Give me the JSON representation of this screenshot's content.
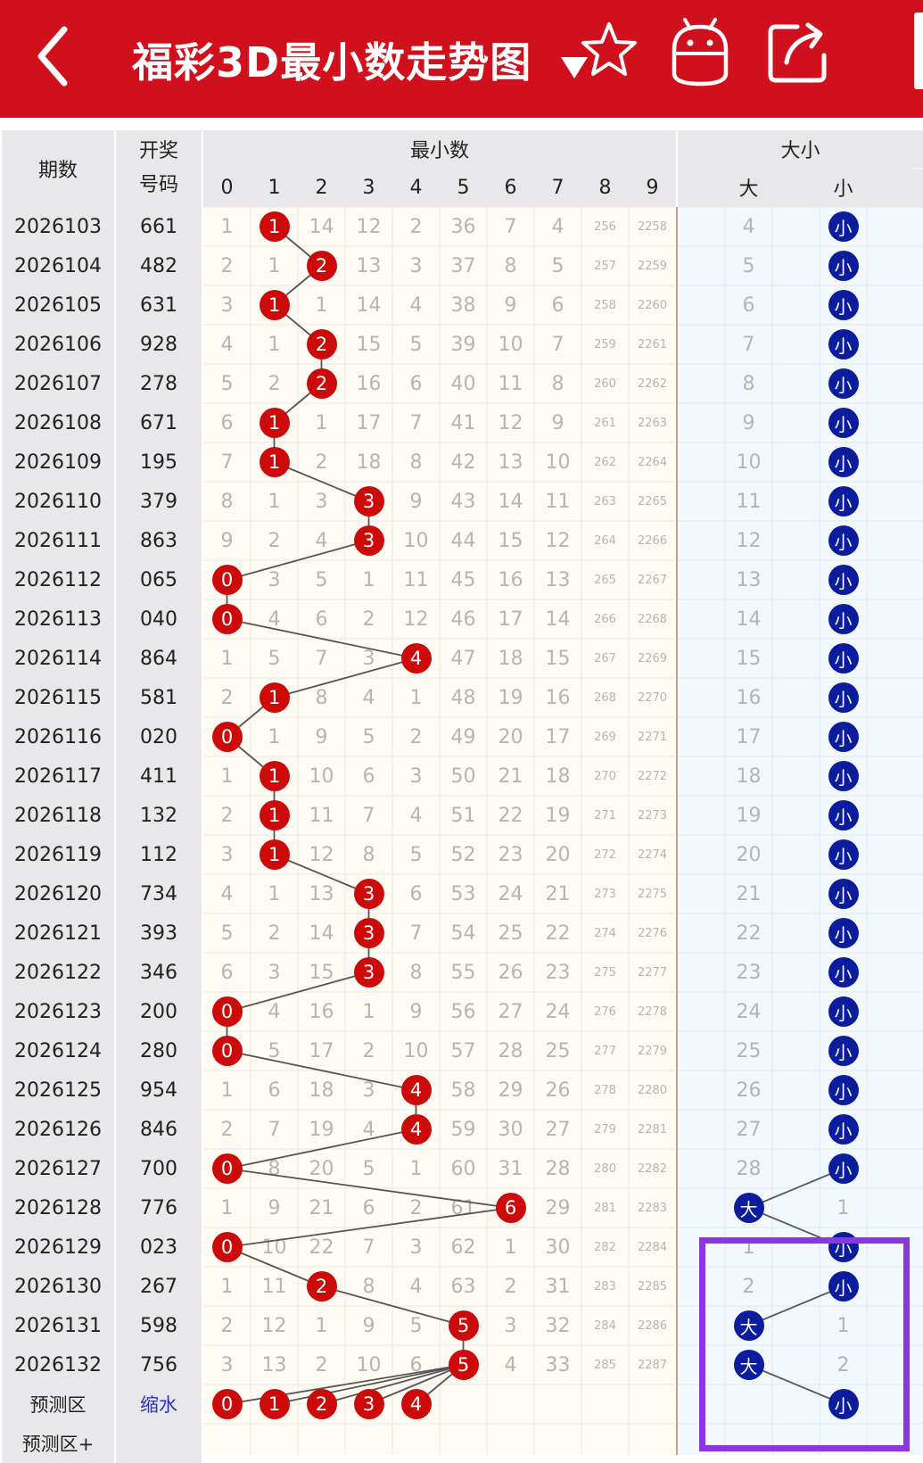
{
  "header": {
    "back_icon": "chevron-left-icon",
    "title": "福彩3D最小数走势图",
    "dropdown_icon": "triangle-down-icon",
    "favorite_icon": "star-icon",
    "robot_icon": "robot-icon",
    "share_icon": "share-icon"
  },
  "table": {
    "col_period": "期数",
    "col_number_line1": "开奖",
    "col_number_line2": "号码",
    "group_min": "最小数",
    "group_size": "大小",
    "digit_headers": [
      "0",
      "1",
      "2",
      "3",
      "4",
      "5",
      "6",
      "7",
      "8",
      "9"
    ],
    "size_headers": [
      "",
      "大",
      "",
      "小",
      ""
    ],
    "rows": [
      {
        "period": "2026103",
        "number": "661",
        "digits": [
          "1",
          "1",
          "14",
          "12",
          "2",
          "36",
          "7",
          "4",
          "256",
          "2258"
        ],
        "hit": 1,
        "size": "小",
        "size_cells": [
          "",
          "4",
          "",
          "小",
          ""
        ]
      },
      {
        "period": "2026104",
        "number": "482",
        "digits": [
          "2",
          "1",
          "2",
          "13",
          "3",
          "37",
          "8",
          "5",
          "257",
          "2259"
        ],
        "hit": 2,
        "size": "小",
        "size_cells": [
          "",
          "5",
          "",
          "小",
          ""
        ]
      },
      {
        "period": "2026105",
        "number": "631",
        "digits": [
          "3",
          "1",
          "1",
          "14",
          "4",
          "38",
          "9",
          "6",
          "258",
          "2260"
        ],
        "hit": 1,
        "size": "小",
        "size_cells": [
          "",
          "6",
          "",
          "小",
          ""
        ]
      },
      {
        "period": "2026106",
        "number": "928",
        "digits": [
          "4",
          "1",
          "2",
          "15",
          "5",
          "39",
          "10",
          "7",
          "259",
          "2261"
        ],
        "hit": 2,
        "size": "小",
        "size_cells": [
          "",
          "7",
          "",
          "小",
          ""
        ]
      },
      {
        "period": "2026107",
        "number": "278",
        "digits": [
          "5",
          "2",
          "2",
          "16",
          "6",
          "40",
          "11",
          "8",
          "260",
          "2262"
        ],
        "hit": 2,
        "size": "小",
        "size_cells": [
          "",
          "8",
          "",
          "小",
          ""
        ]
      },
      {
        "period": "2026108",
        "number": "671",
        "digits": [
          "6",
          "1",
          "1",
          "17",
          "7",
          "41",
          "12",
          "9",
          "261",
          "2263"
        ],
        "hit": 1,
        "size": "小",
        "size_cells": [
          "",
          "9",
          "",
          "小",
          ""
        ]
      },
      {
        "period": "2026109",
        "number": "195",
        "digits": [
          "7",
          "1",
          "2",
          "18",
          "8",
          "42",
          "13",
          "10",
          "262",
          "2264"
        ],
        "hit": 1,
        "size": "小",
        "size_cells": [
          "",
          "10",
          "",
          "小",
          ""
        ]
      },
      {
        "period": "2026110",
        "number": "379",
        "digits": [
          "8",
          "1",
          "3",
          "3",
          "9",
          "43",
          "14",
          "11",
          "263",
          "2265"
        ],
        "hit": 3,
        "size": "小",
        "size_cells": [
          "",
          "11",
          "",
          "小",
          ""
        ]
      },
      {
        "period": "2026111",
        "number": "863",
        "digits": [
          "9",
          "2",
          "4",
          "3",
          "10",
          "44",
          "15",
          "12",
          "264",
          "2266"
        ],
        "hit": 3,
        "size": "小",
        "size_cells": [
          "",
          "12",
          "",
          "小",
          ""
        ]
      },
      {
        "period": "2026112",
        "number": "065",
        "digits": [
          "0",
          "3",
          "5",
          "1",
          "11",
          "45",
          "16",
          "13",
          "265",
          "2267"
        ],
        "hit": 0,
        "size": "小",
        "size_cells": [
          "",
          "13",
          "",
          "小",
          ""
        ]
      },
      {
        "period": "2026113",
        "number": "040",
        "digits": [
          "0",
          "4",
          "6",
          "2",
          "12",
          "46",
          "17",
          "14",
          "266",
          "2268"
        ],
        "hit": 0,
        "size": "小",
        "size_cells": [
          "",
          "14",
          "",
          "小",
          ""
        ]
      },
      {
        "period": "2026114",
        "number": "864",
        "digits": [
          "1",
          "5",
          "7",
          "3",
          "4",
          "47",
          "18",
          "15",
          "267",
          "2269"
        ],
        "hit": 4,
        "size": "小",
        "size_cells": [
          "",
          "15",
          "",
          "小",
          ""
        ]
      },
      {
        "period": "2026115",
        "number": "581",
        "digits": [
          "2",
          "1",
          "8",
          "4",
          "1",
          "48",
          "19",
          "16",
          "268",
          "2270"
        ],
        "hit": 1,
        "size": "小",
        "size_cells": [
          "",
          "16",
          "",
          "小",
          ""
        ]
      },
      {
        "period": "2026116",
        "number": "020",
        "digits": [
          "0",
          "1",
          "9",
          "5",
          "2",
          "49",
          "20",
          "17",
          "269",
          "2271"
        ],
        "hit": 0,
        "size": "小",
        "size_cells": [
          "",
          "17",
          "",
          "小",
          ""
        ]
      },
      {
        "period": "2026117",
        "number": "411",
        "digits": [
          "1",
          "1",
          "10",
          "6",
          "3",
          "50",
          "21",
          "18",
          "270",
          "2272"
        ],
        "hit": 1,
        "size": "小",
        "size_cells": [
          "",
          "18",
          "",
          "小",
          ""
        ]
      },
      {
        "period": "2026118",
        "number": "132",
        "digits": [
          "2",
          "1",
          "11",
          "7",
          "4",
          "51",
          "22",
          "19",
          "271",
          "2273"
        ],
        "hit": 1,
        "size": "小",
        "size_cells": [
          "",
          "19",
          "",
          "小",
          ""
        ]
      },
      {
        "period": "2026119",
        "number": "112",
        "digits": [
          "3",
          "1",
          "12",
          "8",
          "5",
          "52",
          "23",
          "20",
          "272",
          "2274"
        ],
        "hit": 1,
        "size": "小",
        "size_cells": [
          "",
          "20",
          "",
          "小",
          ""
        ]
      },
      {
        "period": "2026120",
        "number": "734",
        "digits": [
          "4",
          "1",
          "13",
          "3",
          "6",
          "53",
          "24",
          "21",
          "273",
          "2275"
        ],
        "hit": 3,
        "size": "小",
        "size_cells": [
          "",
          "21",
          "",
          "小",
          ""
        ]
      },
      {
        "period": "2026121",
        "number": "393",
        "digits": [
          "5",
          "2",
          "14",
          "3",
          "7",
          "54",
          "25",
          "22",
          "274",
          "2276"
        ],
        "hit": 3,
        "size": "小",
        "size_cells": [
          "",
          "22",
          "",
          "小",
          ""
        ]
      },
      {
        "period": "2026122",
        "number": "346",
        "digits": [
          "6",
          "3",
          "15",
          "3",
          "8",
          "55",
          "26",
          "23",
          "275",
          "2277"
        ],
        "hit": 3,
        "size": "小",
        "size_cells": [
          "",
          "23",
          "",
          "小",
          ""
        ]
      },
      {
        "period": "2026123",
        "number": "200",
        "digits": [
          "0",
          "4",
          "16",
          "1",
          "9",
          "56",
          "27",
          "24",
          "276",
          "2278"
        ],
        "hit": 0,
        "size": "小",
        "size_cells": [
          "",
          "24",
          "",
          "小",
          ""
        ]
      },
      {
        "period": "2026124",
        "number": "280",
        "digits": [
          "0",
          "5",
          "17",
          "2",
          "10",
          "57",
          "28",
          "25",
          "277",
          "2279"
        ],
        "hit": 0,
        "size": "小",
        "size_cells": [
          "",
          "25",
          "",
          "小",
          ""
        ]
      },
      {
        "period": "2026125",
        "number": "954",
        "digits": [
          "1",
          "6",
          "18",
          "3",
          "4",
          "58",
          "29",
          "26",
          "278",
          "2280"
        ],
        "hit": 4,
        "size": "小",
        "size_cells": [
          "",
          "26",
          "",
          "小",
          ""
        ]
      },
      {
        "period": "2026126",
        "number": "846",
        "digits": [
          "2",
          "7",
          "19",
          "4",
          "4",
          "59",
          "30",
          "27",
          "279",
          "2281"
        ],
        "hit": 4,
        "size": "小",
        "size_cells": [
          "",
          "27",
          "",
          "小",
          ""
        ]
      },
      {
        "period": "2026127",
        "number": "700",
        "digits": [
          "0",
          "8",
          "20",
          "5",
          "1",
          "60",
          "31",
          "28",
          "280",
          "2282"
        ],
        "hit": 0,
        "size": "小",
        "size_cells": [
          "",
          "28",
          "",
          "小",
          ""
        ]
      },
      {
        "period": "2026128",
        "number": "776",
        "digits": [
          "1",
          "9",
          "21",
          "6",
          "2",
          "61",
          "6",
          "29",
          "281",
          "2283"
        ],
        "hit": 6,
        "size": "大",
        "size_cells": [
          "",
          "大",
          "",
          "1",
          ""
        ]
      },
      {
        "period": "2026129",
        "number": "023",
        "digits": [
          "0",
          "10",
          "22",
          "7",
          "3",
          "62",
          "1",
          "30",
          "282",
          "2284"
        ],
        "hit": 0,
        "size": "小",
        "size_cells": [
          "",
          "1",
          "",
          "小",
          ""
        ]
      },
      {
        "period": "2026130",
        "number": "267",
        "digits": [
          "1",
          "11",
          "2",
          "8",
          "4",
          "63",
          "2",
          "31",
          "283",
          "2285"
        ],
        "hit": 2,
        "size": "小",
        "size_cells": [
          "",
          "2",
          "",
          "小",
          ""
        ]
      },
      {
        "period": "2026131",
        "number": "598",
        "digits": [
          "2",
          "12",
          "1",
          "9",
          "5",
          "5",
          "3",
          "32",
          "284",
          "2286"
        ],
        "hit": 5,
        "size": "大",
        "size_cells": [
          "",
          "大",
          "",
          "1",
          ""
        ]
      },
      {
        "period": "2026132",
        "number": "756",
        "digits": [
          "3",
          "13",
          "2",
          "10",
          "6",
          "5",
          "4",
          "33",
          "285",
          "2287"
        ],
        "hit": 5,
        "size": "大",
        "size_cells": [
          "",
          "大",
          "",
          "2",
          ""
        ]
      }
    ],
    "prediction": {
      "label": "预测区",
      "value": "缩水",
      "balls": [
        "0",
        "1",
        "2",
        "3",
        "4"
      ],
      "size_ball": "小"
    },
    "prediction_plus": {
      "label": "预测区+"
    }
  },
  "colors": {
    "brand_red": "#d0101c",
    "ball_red": "#cc0a0a",
    "ball_blue": "#0b1c9c",
    "highlight_purple": "#8f35e0",
    "header_gray": "#e8e8ea",
    "missing_text": "#b5b5b5"
  }
}
